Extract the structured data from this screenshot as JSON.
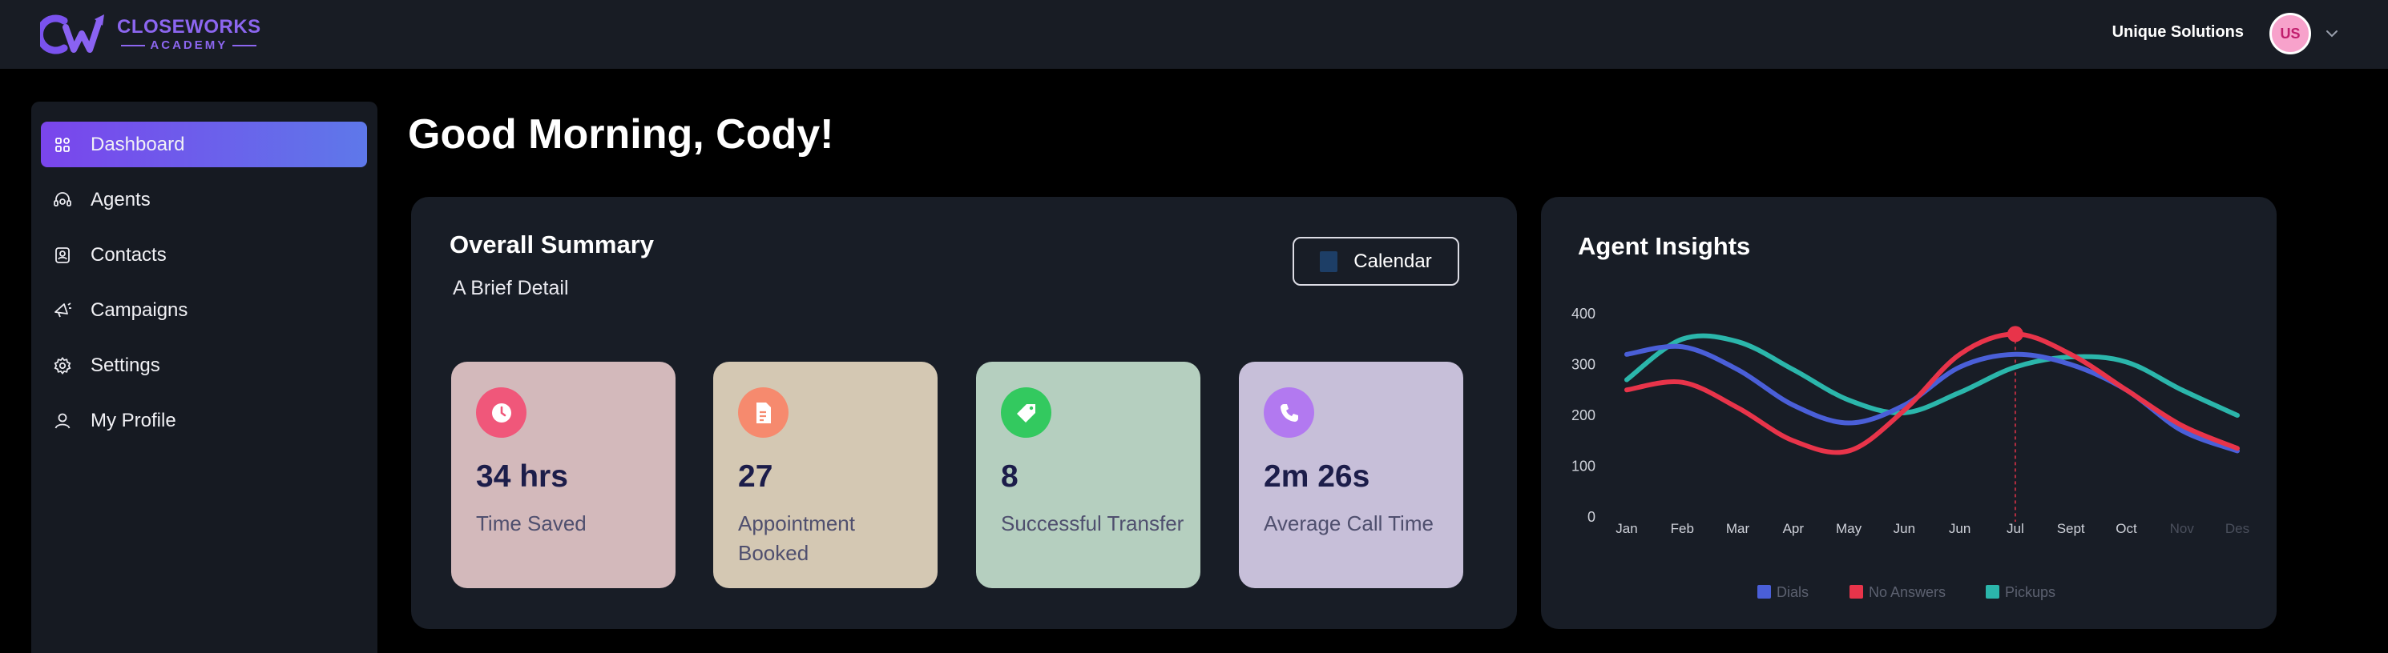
{
  "header": {
    "logo_title": "CLOSEWORKS",
    "logo_sub": "ACADEMY",
    "org_name": "Unique Solutions",
    "avatar_initials": "US"
  },
  "sidebar": {
    "items": [
      {
        "label": "Dashboard",
        "icon": "grid-icon",
        "active": true
      },
      {
        "label": "Agents",
        "icon": "headset-icon",
        "active": false
      },
      {
        "label": "Contacts",
        "icon": "contact-book-icon",
        "active": false
      },
      {
        "label": "Campaigns",
        "icon": "megaphone-icon",
        "active": false
      },
      {
        "label": "Settings",
        "icon": "gear-icon",
        "active": false
      },
      {
        "label": "My Profile",
        "icon": "user-icon",
        "active": false
      }
    ]
  },
  "main": {
    "greeting": "Good Morning, Cody!",
    "summary": {
      "title": "Overall Summary",
      "subtitle": "A Brief Detail",
      "calendar_label": "Calendar",
      "stats": [
        {
          "value": "34 hrs",
          "label": "Time Saved",
          "icon": "clock-icon",
          "bg": "#d3b9bb",
          "icon_bg": "#f0577a"
        },
        {
          "value": "27",
          "label": "Appointment Booked",
          "icon": "document-icon",
          "bg": "#d4c8b3",
          "icon_bg": "#f68a6e"
        },
        {
          "value": "8",
          "label": "Successful Transfer",
          "icon": "tag-icon",
          "bg": "#b5cfbf",
          "icon_bg": "#33c95f"
        },
        {
          "value": "2m 26s",
          "label": "Average Call Time",
          "icon": "phone-icon",
          "bg": "#c7bfd9",
          "icon_bg": "#b279f0"
        }
      ]
    },
    "insights": {
      "title": "Agent Insights"
    }
  },
  "colors": {
    "accent_purple": "#7a45ec",
    "dials": "#4a5fd8",
    "no_answers": "#e8344a",
    "pickups": "#2bb6ab"
  },
  "chart_data": {
    "type": "line",
    "title": "Agent Insights",
    "categories": [
      "Jan",
      "Feb",
      "Mar",
      "Apr",
      "May",
      "Jun",
      "Jun",
      "Jul",
      "Sept",
      "Oct",
      "Nov",
      "Des"
    ],
    "yticks": [
      0,
      100,
      200,
      300,
      400
    ],
    "ylim": [
      0,
      400
    ],
    "grid": false,
    "legend_position": "bottom",
    "highlight": {
      "category": "Jul",
      "series": "No Answers",
      "value": 360
    },
    "series": [
      {
        "name": "Dials",
        "color": "#4a5fd8",
        "values": [
          320,
          335,
          290,
          220,
          185,
          220,
          295,
          320,
          300,
          250,
          170,
          130
        ]
      },
      {
        "name": "No Answers",
        "color": "#e8344a",
        "values": [
          250,
          265,
          215,
          150,
          130,
          210,
          320,
          360,
          320,
          250,
          180,
          135
        ]
      },
      {
        "name": "Pickups",
        "color": "#2bb6ab",
        "values": [
          270,
          350,
          345,
          290,
          230,
          205,
          245,
          295,
          315,
          305,
          250,
          200
        ]
      }
    ]
  }
}
